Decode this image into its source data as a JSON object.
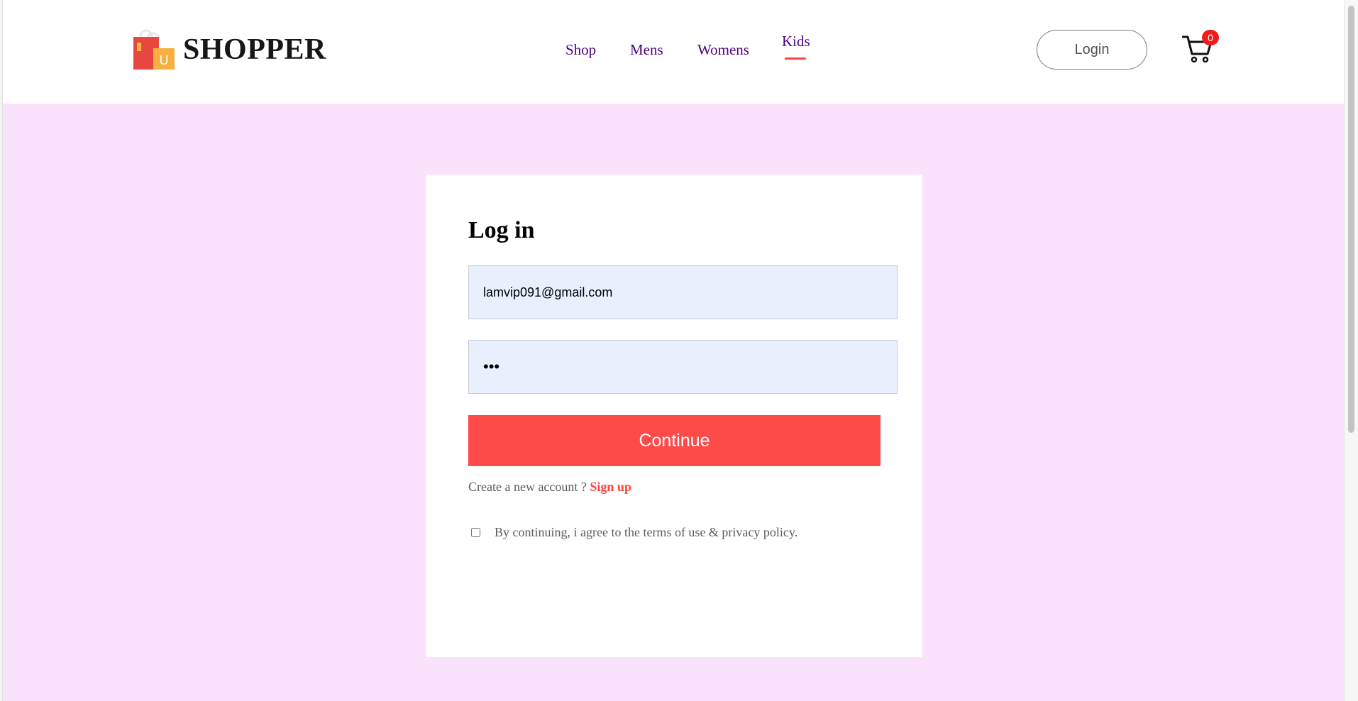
{
  "brand": {
    "name": "SHOPPER",
    "logo_letter": "U",
    "colors": {
      "accent": "#ff4141",
      "nav_text": "#4b0082",
      "section_bg": "#fae1fc"
    }
  },
  "nav": {
    "items": [
      {
        "label": "Shop"
      },
      {
        "label": "Mens"
      },
      {
        "label": "Womens"
      },
      {
        "label": "Kids",
        "active": true
      }
    ]
  },
  "header": {
    "login_label": "Login",
    "cart_count": "0",
    "cart_icon": "cart-icon"
  },
  "login": {
    "title": "Log in",
    "email_value": "lamvip091@gmail.com",
    "password_value": "•••",
    "continue_label": "Continue",
    "signup_prompt": "Create a new account ?",
    "signup_link": "Sign up",
    "agree_text": "By continuing, i agree to the terms of use & privacy policy.",
    "agree_checked": false
  }
}
